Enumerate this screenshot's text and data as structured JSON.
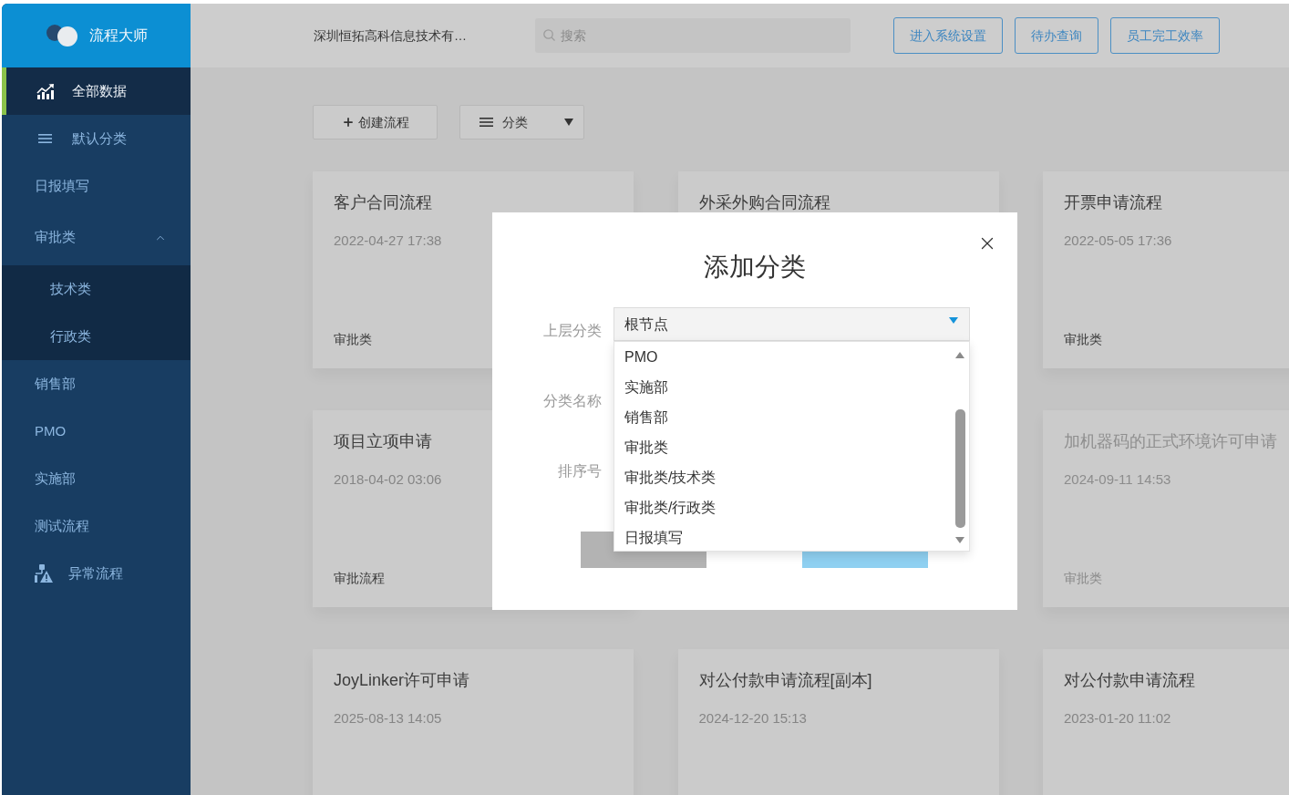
{
  "sidebar": {
    "logo": {
      "title": "流程大师"
    },
    "items": [
      {
        "label": "全部数据",
        "kind": "overview",
        "selected": true
      },
      {
        "label": "默认分类",
        "kind": "catalog",
        "selected": false
      },
      {
        "label": "日报填写",
        "kind": "plain",
        "selected": false
      },
      {
        "label": "审批类",
        "kind": "group",
        "selected": false,
        "expanded": true,
        "children": [
          {
            "label": "技术类",
            "selected": false
          },
          {
            "label": "行政类",
            "selected": false
          }
        ]
      },
      {
        "label": "销售部",
        "kind": "plain",
        "selected": false
      },
      {
        "label": "PMO",
        "kind": "plain",
        "selected": false
      },
      {
        "label": "实施部",
        "kind": "plain",
        "selected": false
      },
      {
        "label": "测试流程",
        "kind": "plain",
        "selected": false
      },
      {
        "label": "异常流程",
        "kind": "alert",
        "selected": false
      }
    ]
  },
  "header": {
    "company": "深圳恒拓高科信息技术有…",
    "search": {
      "placeholder": "搜索"
    },
    "buttons": [
      "进入系统设置",
      "待办查询",
      "员工完工效率"
    ]
  },
  "toolbar": {
    "buttons": [
      {
        "label": "创建流程",
        "kind": "create"
      },
      {
        "label": "分类",
        "kind": "menu"
      }
    ]
  },
  "card_rows": [
    {
      "cards": [
        {
          "title": "客户合同流程",
          "date": "2022-04-27 17:38",
          "category": "审批类",
          "disabled": false
        },
        {
          "title": "外采外购合同流程",
          "disabled": false
        },
        {
          "title": "开票申请流程",
          "date": "2022-05-05 17:36",
          "category": "审批类",
          "disabled": false
        }
      ]
    },
    {
      "cards": [
        {
          "title": "项目立项申请",
          "date": "2018-04-02 03:06",
          "category": "审批流程",
          "disabled": false
        },
        {
          "title": "加机器码的正式环境许可申请",
          "date": "2024-09-11 14:53",
          "category": "审批类",
          "disabled": true
        }
      ]
    },
    {
      "cards": [
        {
          "title": "JoyLinker许可申请",
          "date": "2025-08-13 14:05",
          "disabled": false
        },
        {
          "title": "对公付款申请流程[副本]",
          "date": "2024-12-20 15:13",
          "disabled": false
        },
        {
          "title": "对公付款申请流程",
          "date": "2023-01-20 11:02",
          "disabled": false
        }
      ]
    }
  ],
  "dialog": {
    "title": "添加分类",
    "fields": [
      {
        "label": "上层分类",
        "select": {
          "value": "根节点",
          "expanded": true,
          "options": [
            {
              "label": "PMO",
              "selected": false
            },
            {
              "label": "实施部",
              "selected": false
            },
            {
              "label": "销售部",
              "selected": false
            },
            {
              "label": "审批类",
              "selected": false
            },
            {
              "label": "审批类/技术类",
              "selected": false
            },
            {
              "label": "审批类/行政类",
              "selected": false
            },
            {
              "label": "日报填写",
              "selected": false
            }
          ]
        }
      },
      {
        "label": "分类名称"
      },
      {
        "label": "排序号"
      }
    ],
    "buttons": [
      {
        "kind": "secondary"
      },
      {
        "kind": "primary"
      }
    ]
  }
}
